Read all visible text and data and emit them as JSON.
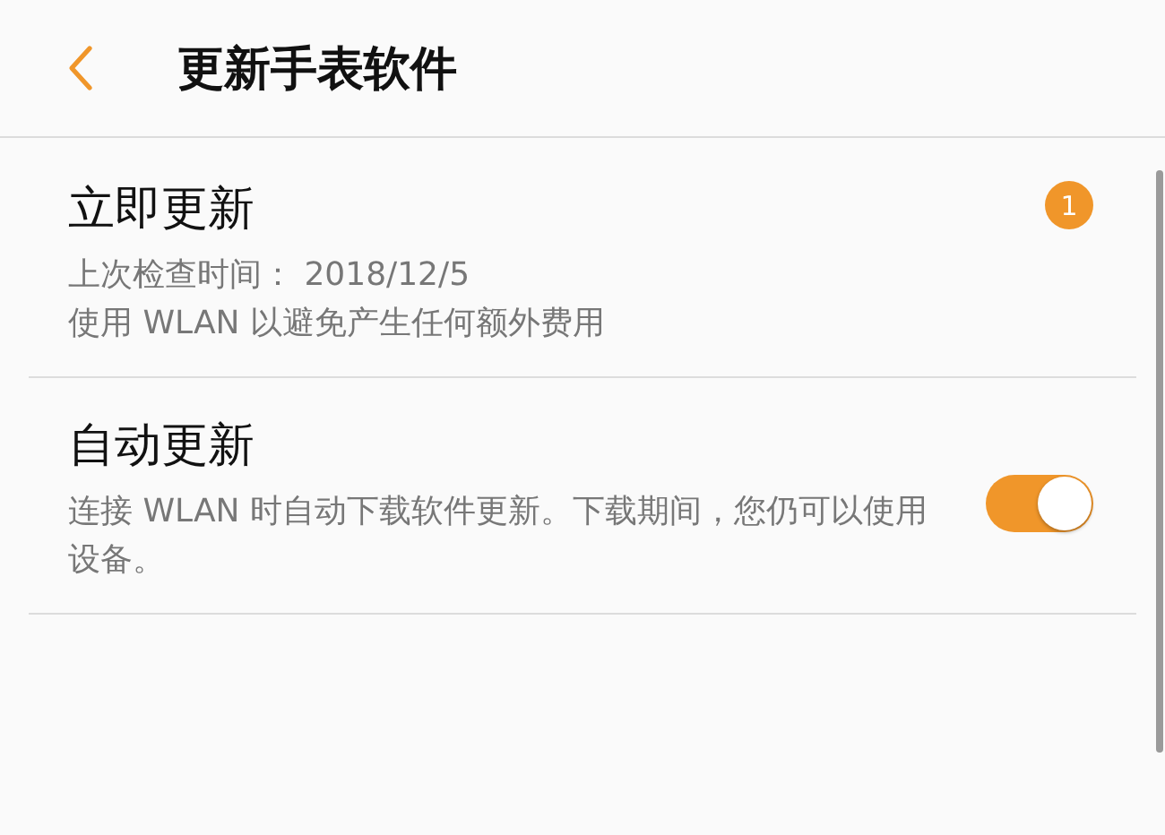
{
  "header": {
    "title": "更新手表软件"
  },
  "items": [
    {
      "kind": "badge",
      "title": "立即更新",
      "lines": [
        "上次检查时间： 2018/12/5",
        "使用 WLAN 以避免产生任何额外费用"
      ],
      "badge": "1"
    },
    {
      "kind": "toggle",
      "title": "自动更新",
      "lines": [
        "连接 WLAN 时自动下载软件更新。下载期间，您仍可以使用设备。"
      ],
      "on": true
    }
  ]
}
